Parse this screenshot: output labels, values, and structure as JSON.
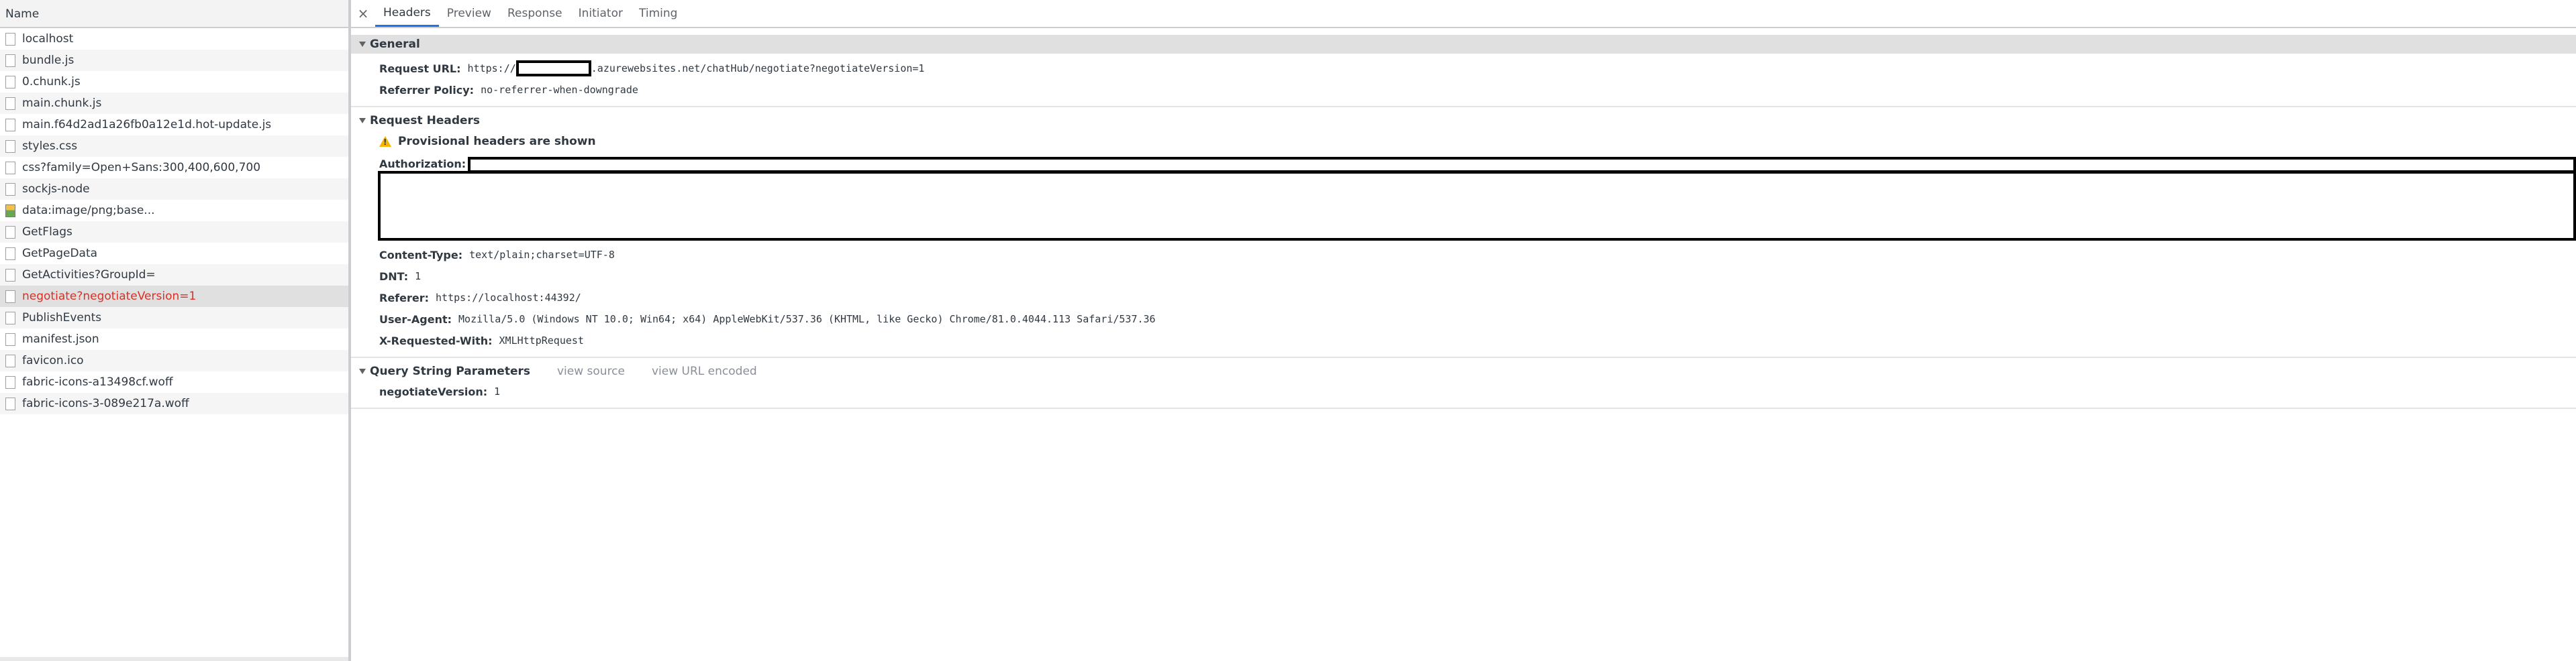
{
  "left_panel": {
    "header_label": "Name",
    "requests": [
      {
        "label": "localhost",
        "icon": "document-icon"
      },
      {
        "label": "bundle.js",
        "icon": "document-icon"
      },
      {
        "label": "0.chunk.js",
        "icon": "document-icon"
      },
      {
        "label": "main.chunk.js",
        "icon": "document-icon"
      },
      {
        "label": "main.f64d2ad1a26fb0a12e1d.hot-update.js",
        "icon": "document-icon"
      },
      {
        "label": "styles.css",
        "icon": "document-icon"
      },
      {
        "label": "css?family=Open+Sans:300,400,600,700",
        "icon": "document-icon"
      },
      {
        "label": "sockjs-node",
        "icon": "document-icon"
      },
      {
        "label": "data:image/png;base...",
        "icon": "image-icon"
      },
      {
        "label": "GetFlags",
        "icon": "document-icon"
      },
      {
        "label": "GetPageData",
        "icon": "document-icon"
      },
      {
        "label": "GetActivities?GroupId=",
        "icon": "document-icon"
      },
      {
        "label": "negotiate?negotiateVersion=1",
        "icon": "document-icon",
        "selected": true,
        "color": "#d93025"
      },
      {
        "label": "PublishEvents",
        "icon": "document-icon"
      },
      {
        "label": "manifest.json",
        "icon": "document-icon"
      },
      {
        "label": "favicon.ico",
        "icon": "document-icon"
      },
      {
        "label": "fabric-icons-a13498cf.woff",
        "icon": "document-icon"
      },
      {
        "label": "fabric-icons-3-089e217a.woff",
        "icon": "document-icon"
      }
    ]
  },
  "tabs": {
    "close": "×",
    "items": [
      "Headers",
      "Preview",
      "Response",
      "Initiator",
      "Timing"
    ],
    "active": "Headers",
    "active_color": "#1a73e8"
  },
  "general": {
    "title": "General",
    "request_url_label": "Request URL:",
    "request_url_prefix": "https://",
    "request_url_suffix": ".azurewebsites.net/chatHub/negotiate?negotiateVersion=1",
    "referrer_policy_label": "Referrer Policy:",
    "referrer_policy_value": "no-referrer-when-downgrade"
  },
  "request_headers": {
    "title": "Request Headers",
    "warning": "Provisional headers are shown",
    "warning_color": "#f4b400",
    "authorization_label": "Authorization:",
    "content_type_label": "Content-Type:",
    "content_type_value": "text/plain;charset=UTF-8",
    "dnt_label": "DNT:",
    "dnt_value": "1",
    "referer_label": "Referer:",
    "referer_value": "https://localhost:44392/",
    "user_agent_label": "User-Agent:",
    "user_agent_value": "Mozilla/5.0 (Windows NT 10.0; Win64; x64) AppleWebKit/537.36 (KHTML, like Gecko) Chrome/81.0.4044.113 Safari/537.36",
    "x_requested_with_label": "X-Requested-With:",
    "x_requested_with_value": "XMLHttpRequest"
  },
  "query_string": {
    "title": "Query String Parameters",
    "view_source": "view source",
    "view_url_encoded": "view URL encoded",
    "param_label": "negotiateVersion:",
    "param_value": "1"
  }
}
